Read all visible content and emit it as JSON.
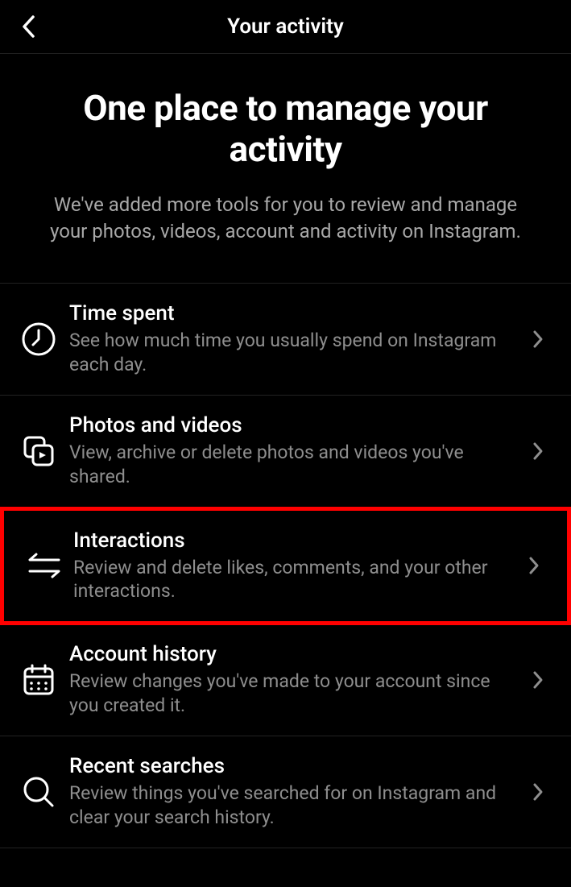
{
  "header": {
    "title": "Your activity"
  },
  "intro": {
    "title": "One place to manage your activity",
    "description": "We've added more tools for you to review and manage your photos, videos, account and activity on Instagram."
  },
  "items": [
    {
      "icon": "clock",
      "title": "Time spent",
      "description": "See how much time you usually spend on Instagram each day.",
      "highlighted": false
    },
    {
      "icon": "media",
      "title": "Photos and videos",
      "description": "View, archive or delete photos and videos you've shared.",
      "highlighted": false
    },
    {
      "icon": "arrows",
      "title": "Interactions",
      "description": "Review and delete likes, comments, and your other interactions.",
      "highlighted": true
    },
    {
      "icon": "calendar",
      "title": "Account history",
      "description": "Review changes you've made to your account since you created it.",
      "highlighted": false
    },
    {
      "icon": "search",
      "title": "Recent searches",
      "description": "Review things you've searched for on Instagram and clear your search history.",
      "highlighted": false
    }
  ]
}
